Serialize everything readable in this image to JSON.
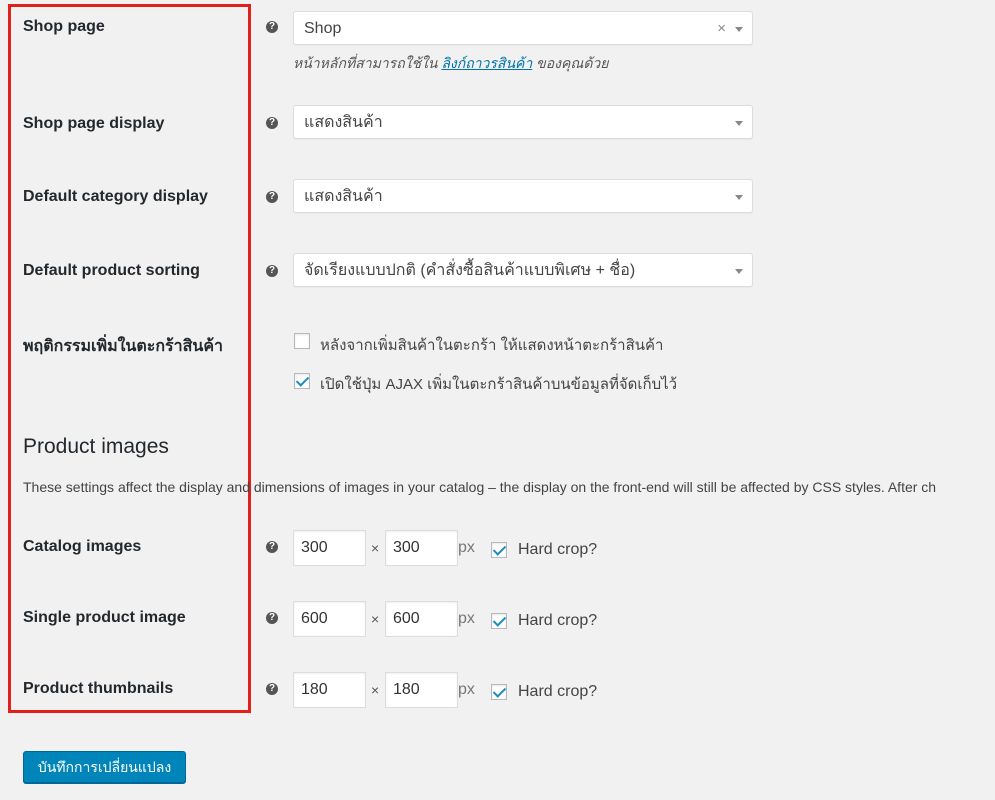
{
  "settings": {
    "shop_page": {
      "label": "Shop page",
      "value": "Shop",
      "clear": "×",
      "desc_before": "หน้าหลักที่สามารถใช้ใน ",
      "desc_link": "ลิงก์ถาวรสินค้า",
      "desc_after": " ของคุณด้วย"
    },
    "shop_page_display": {
      "label": "Shop page display",
      "value": "แสดงสินค้า"
    },
    "default_category_display": {
      "label": "Default category display",
      "value": "แสดงสินค้า"
    },
    "default_product_sorting": {
      "label": "Default product sorting",
      "value": "จัดเรียงแบบปกติ (คำสั่งซื้อสินค้าแบบพิเศษ + ชื่อ)"
    },
    "add_to_cart": {
      "label": "พฤติกรรมเพิ่มในตะกร้าสินค้า",
      "options": [
        {
          "text": "หลังจากเพิ่มสินค้าในตะกร้า ให้แสดงหน้าตะกร้าสินค้า",
          "checked": false
        },
        {
          "text": "เปิดใช้ปุ่ม AJAX เพิ่มในตะกร้าสินค้าบนข้อมูลที่จัดเก็บไว้",
          "checked": true
        }
      ]
    }
  },
  "product_images": {
    "heading": "Product images",
    "intro": "These settings affect the display and dimensions of images in your catalog – the display on the front-end will still be affected by CSS styles. After ch",
    "rows": [
      {
        "label": "Catalog images",
        "width": "300",
        "height": "300",
        "times": "×",
        "unit": "px",
        "crop_label": "Hard crop?",
        "crop": true
      },
      {
        "label": "Single product image",
        "width": "600",
        "height": "600",
        "times": "×",
        "unit": "px",
        "crop_label": "Hard crop?",
        "crop": true
      },
      {
        "label": "Product thumbnails",
        "width": "180",
        "height": "180",
        "times": "×",
        "unit": "px",
        "crop_label": "Hard crop?",
        "crop": true
      }
    ]
  },
  "help_icon": "help-circle-icon",
  "help_glyph": "?",
  "save_button": "บันทึกการเปลี่ยนแปลง",
  "colors": {
    "accent": "#0085ba",
    "highlight_border": "#e0201b",
    "link": "#0073aa"
  }
}
